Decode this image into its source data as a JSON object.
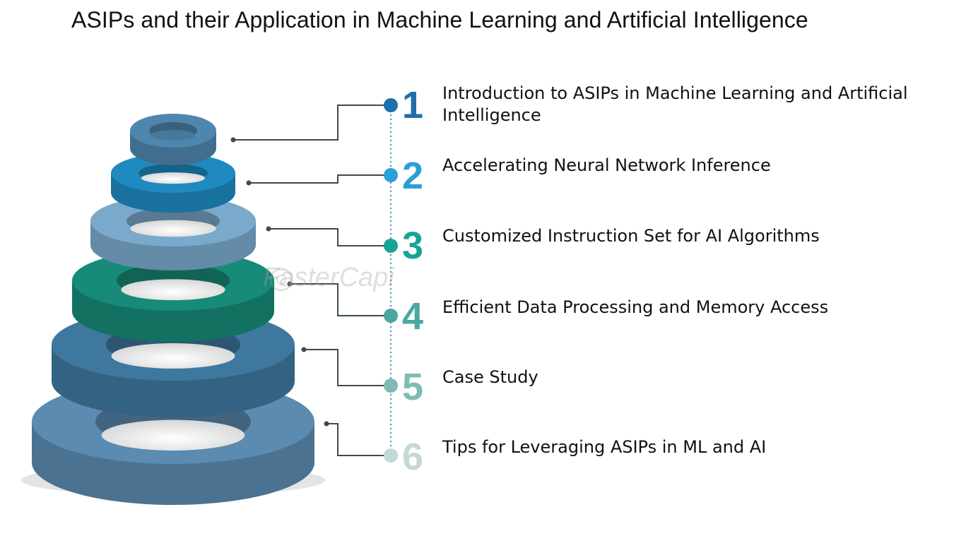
{
  "title": "ASIPs and their Application in Machine Learning and Artificial Intelligence",
  "watermark": "FasterCapi",
  "items": [
    {
      "number": "1",
      "label": "Introduction to ASIPs in Machine Learning and Artificial Intelligence",
      "color": "#1f6fad"
    },
    {
      "number": "2",
      "label": "Accelerating Neural Network Inference",
      "color": "#2a9fd8"
    },
    {
      "number": "3",
      "label": "Customized Instruction Set for AI Algorithms",
      "color": "#18a397"
    },
    {
      "number": "4",
      "label": "Efficient Data Processing and Memory Access",
      "color": "#4aa89e"
    },
    {
      "number": "5",
      "label": "Case Study",
      "color": "#7cbcb5"
    },
    {
      "number": "6",
      "label": "Tips for Leveraging ASIPs in ML and AI",
      "color": "#c4d8d5"
    }
  ],
  "ring_colors": [
    "#4f86ad",
    "#1f8ac0",
    "#7aa9cc",
    "#178a78",
    "#3f789e",
    "#5b8bb0"
  ]
}
